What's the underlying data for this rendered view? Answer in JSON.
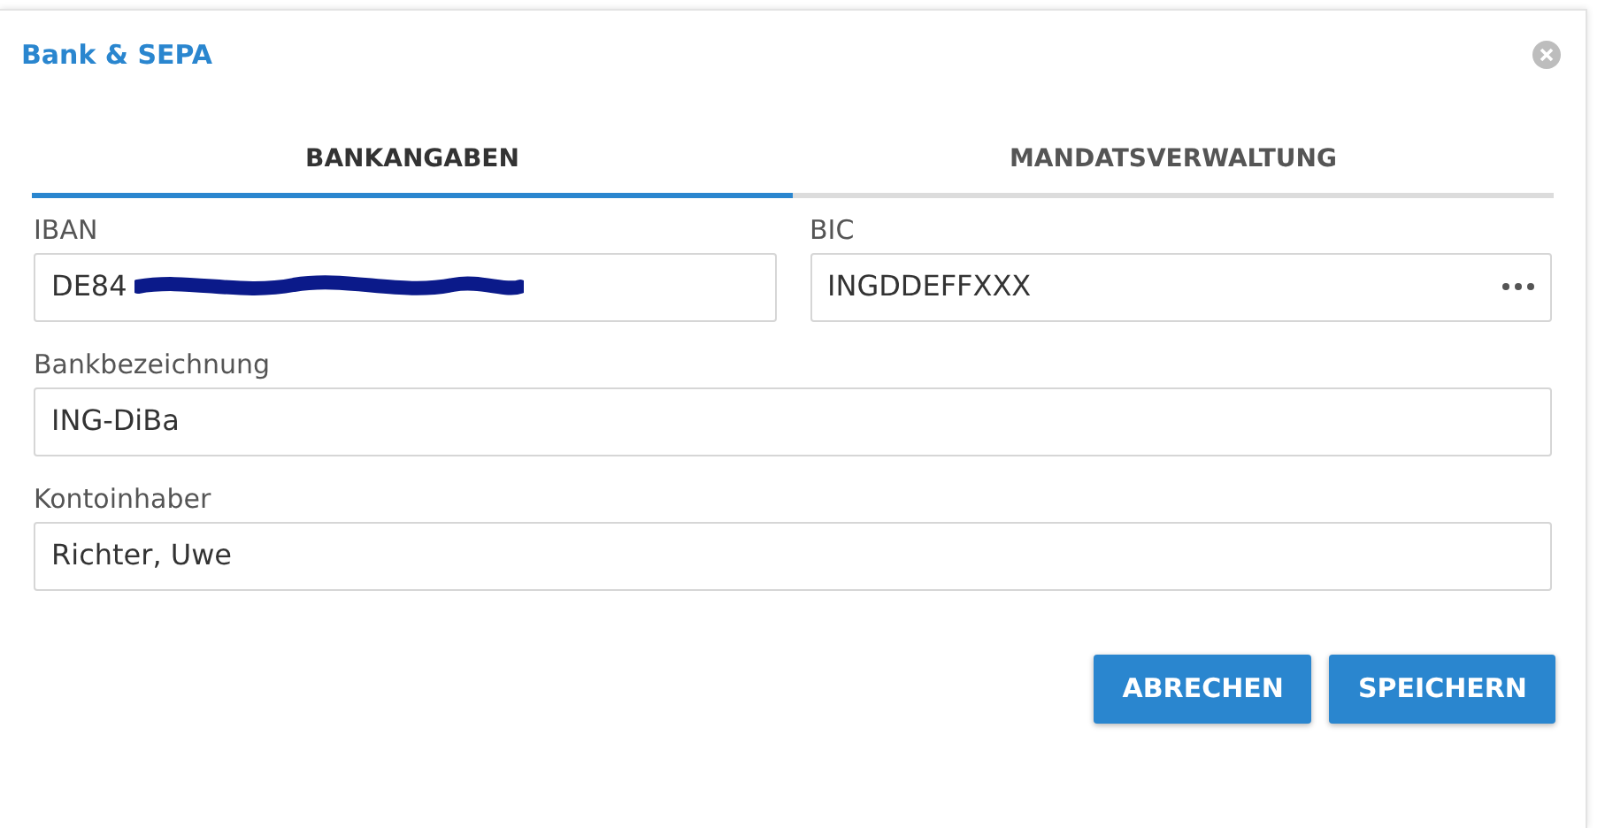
{
  "dialog": {
    "title": "Bank & SEPA"
  },
  "tabs": [
    {
      "label": "BANKANGABEN",
      "selected": true
    },
    {
      "label": "MANDATSVERWALTUNG",
      "selected": false
    }
  ],
  "rows": [
    [
      {
        "label": "IBAN",
        "value": "DE84",
        "kind": "redacted"
      },
      {
        "label": "BIC",
        "value": "INGDDEFFXXX",
        "kind": "lookup"
      }
    ],
    [
      {
        "label": "Bankbezeichnung",
        "value": "ING-DiBa",
        "kind": "text"
      }
    ],
    [
      {
        "label": "Kontoinhaber",
        "value": "Richter, Uwe",
        "kind": "text"
      }
    ]
  ],
  "buttons": [
    "ABRECHEN",
    "SPEICHERN"
  ]
}
